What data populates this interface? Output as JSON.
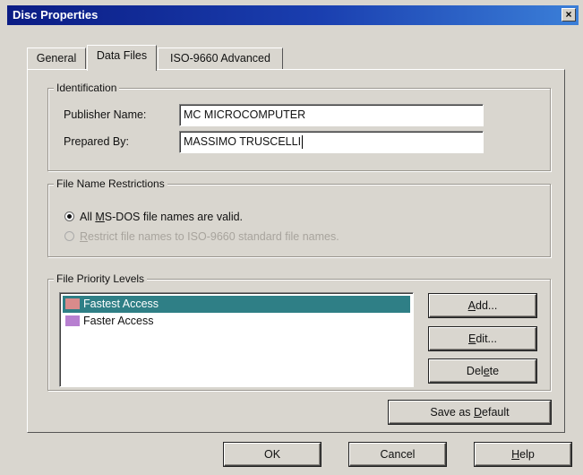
{
  "window": {
    "title": "Disc Properties",
    "close_glyph": "×"
  },
  "tabs": [
    {
      "label": "General"
    },
    {
      "label": "Data Files"
    },
    {
      "label": "ISO-9660 Advanced"
    }
  ],
  "identification": {
    "title": "Identification",
    "publisher_label": "Publisher Name:",
    "publisher_value": "MC MICROCOMPUTER",
    "prepared_label": "Prepared By:",
    "prepared_value": "MASSIMO TRUSCELLI"
  },
  "restrictions": {
    "title": "File Name Restrictions",
    "option1": {
      "pre": "All ",
      "mnemonic": "M",
      "post": "S-DOS file names are valid.",
      "checked": true
    },
    "option2": {
      "pre": "",
      "mnemonic": "R",
      "post": "estrict file names to ISO-9660 standard file names.",
      "checked": false,
      "enabled": false
    }
  },
  "priority": {
    "title": "File Priority Levels",
    "items": [
      {
        "label": "Fastest Access",
        "color": "#d98b8b",
        "selected": true
      },
      {
        "label": "Faster Access",
        "color": "#b77fd0",
        "selected": false
      }
    ],
    "add": {
      "mnemonic": "A",
      "rest": "dd..."
    },
    "edit": {
      "mnemonic": "E",
      "rest": "dit..."
    },
    "delete": {
      "pre": "Del",
      "mnemonic": "e",
      "post": "te"
    }
  },
  "save_default": {
    "pre": "Save as ",
    "mnemonic": "D",
    "post": "efault"
  },
  "footer": {
    "ok": "OK",
    "cancel": "Cancel",
    "help": {
      "mnemonic": "H",
      "rest": "elp"
    }
  },
  "colors": {
    "title_start": "#0b1c84",
    "title_end": "#3b7fd8",
    "selection": "#2f7f86",
    "face": "#d9d6cf"
  }
}
